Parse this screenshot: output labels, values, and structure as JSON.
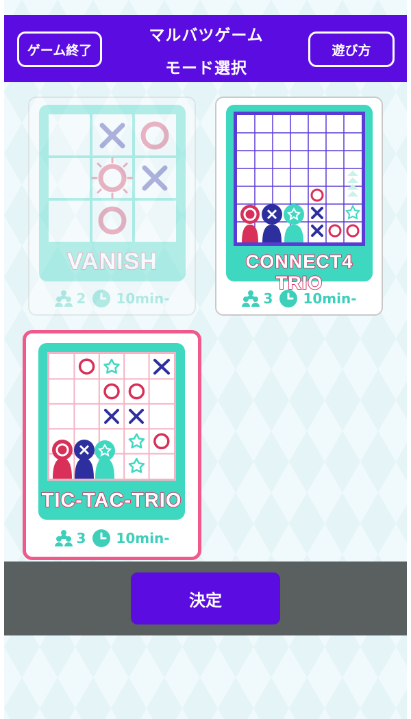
{
  "header": {
    "title_line1": "マルバツゲーム",
    "title_line2": "モード選択",
    "exit_label": "ゲーム終了",
    "howto_label": "遊び方",
    "color": "#5b0ce0"
  },
  "modes": [
    {
      "title": "VANISH",
      "players": "2",
      "duration": "10min-",
      "state": "disabled"
    },
    {
      "title": "CONNECT4 TRIO",
      "players": "3",
      "duration": "10min-",
      "state": "normal"
    },
    {
      "title": "TIC-TAC-TRIO",
      "players": "3",
      "duration": "10min-",
      "state": "selected"
    }
  ],
  "icons": {
    "players": "players-icon",
    "clock": "clock-icon"
  },
  "footer": {
    "confirm_label": "決定"
  },
  "colors": {
    "accent_purple": "#5b0ce0",
    "teal": "#3ed8c1",
    "pink": "#ef5a8a",
    "navy": "#2e2f9e",
    "red": "#d83058"
  }
}
